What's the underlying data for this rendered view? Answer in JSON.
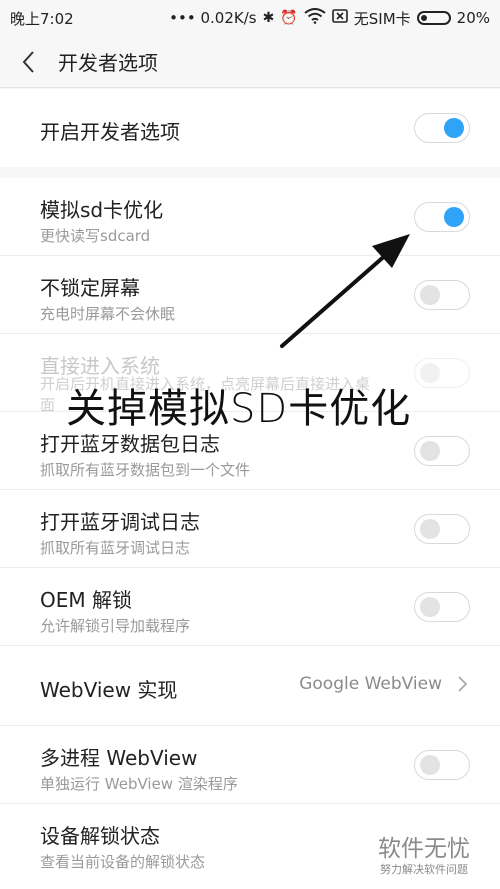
{
  "status_bar": {
    "time": "晚上7:02",
    "speed": "••• 0.02K/s",
    "sim": "无SIM卡",
    "battery": "20%"
  },
  "header": {
    "title": "开发者选项"
  },
  "master": {
    "label": "开启开发者选项",
    "enabled": true
  },
  "settings": [
    {
      "label": "模拟sd卡优化",
      "sub": "更快读写sdcard",
      "toggle": "on"
    },
    {
      "label": "不锁定屏幕",
      "sub": "充电时屏幕不会休眠",
      "toggle": "off"
    },
    {
      "label": "直接进入系统",
      "sub": "开启后开机直接进入系统，点亮屏幕后直接进入桌面",
      "toggle": "disabled"
    },
    {
      "label": "打开蓝牙数据包日志",
      "sub": "抓取所有蓝牙数据包到一个文件",
      "toggle": "off"
    },
    {
      "label": "打开蓝牙调试日志",
      "sub": "抓取所有蓝牙调试日志",
      "toggle": "off"
    },
    {
      "label": "OEM 解锁",
      "sub": "允许解锁引导加载程序",
      "toggle": "off"
    },
    {
      "label": "WebView 实现",
      "value": "Google WebView"
    },
    {
      "label": "多进程 WebView",
      "sub": "单独运行 WebView 渲染程序",
      "toggle": "off"
    },
    {
      "label": "设备解锁状态",
      "sub": "查看当前设备的解锁状态"
    }
  ],
  "annotation": {
    "text": "关掉模拟SD卡优化"
  },
  "watermark": {
    "main": "软件无忧",
    "sub": "努力解决软件问题"
  },
  "colors": {
    "accent": "#2fa3f7",
    "background": "#f7f7f7"
  }
}
